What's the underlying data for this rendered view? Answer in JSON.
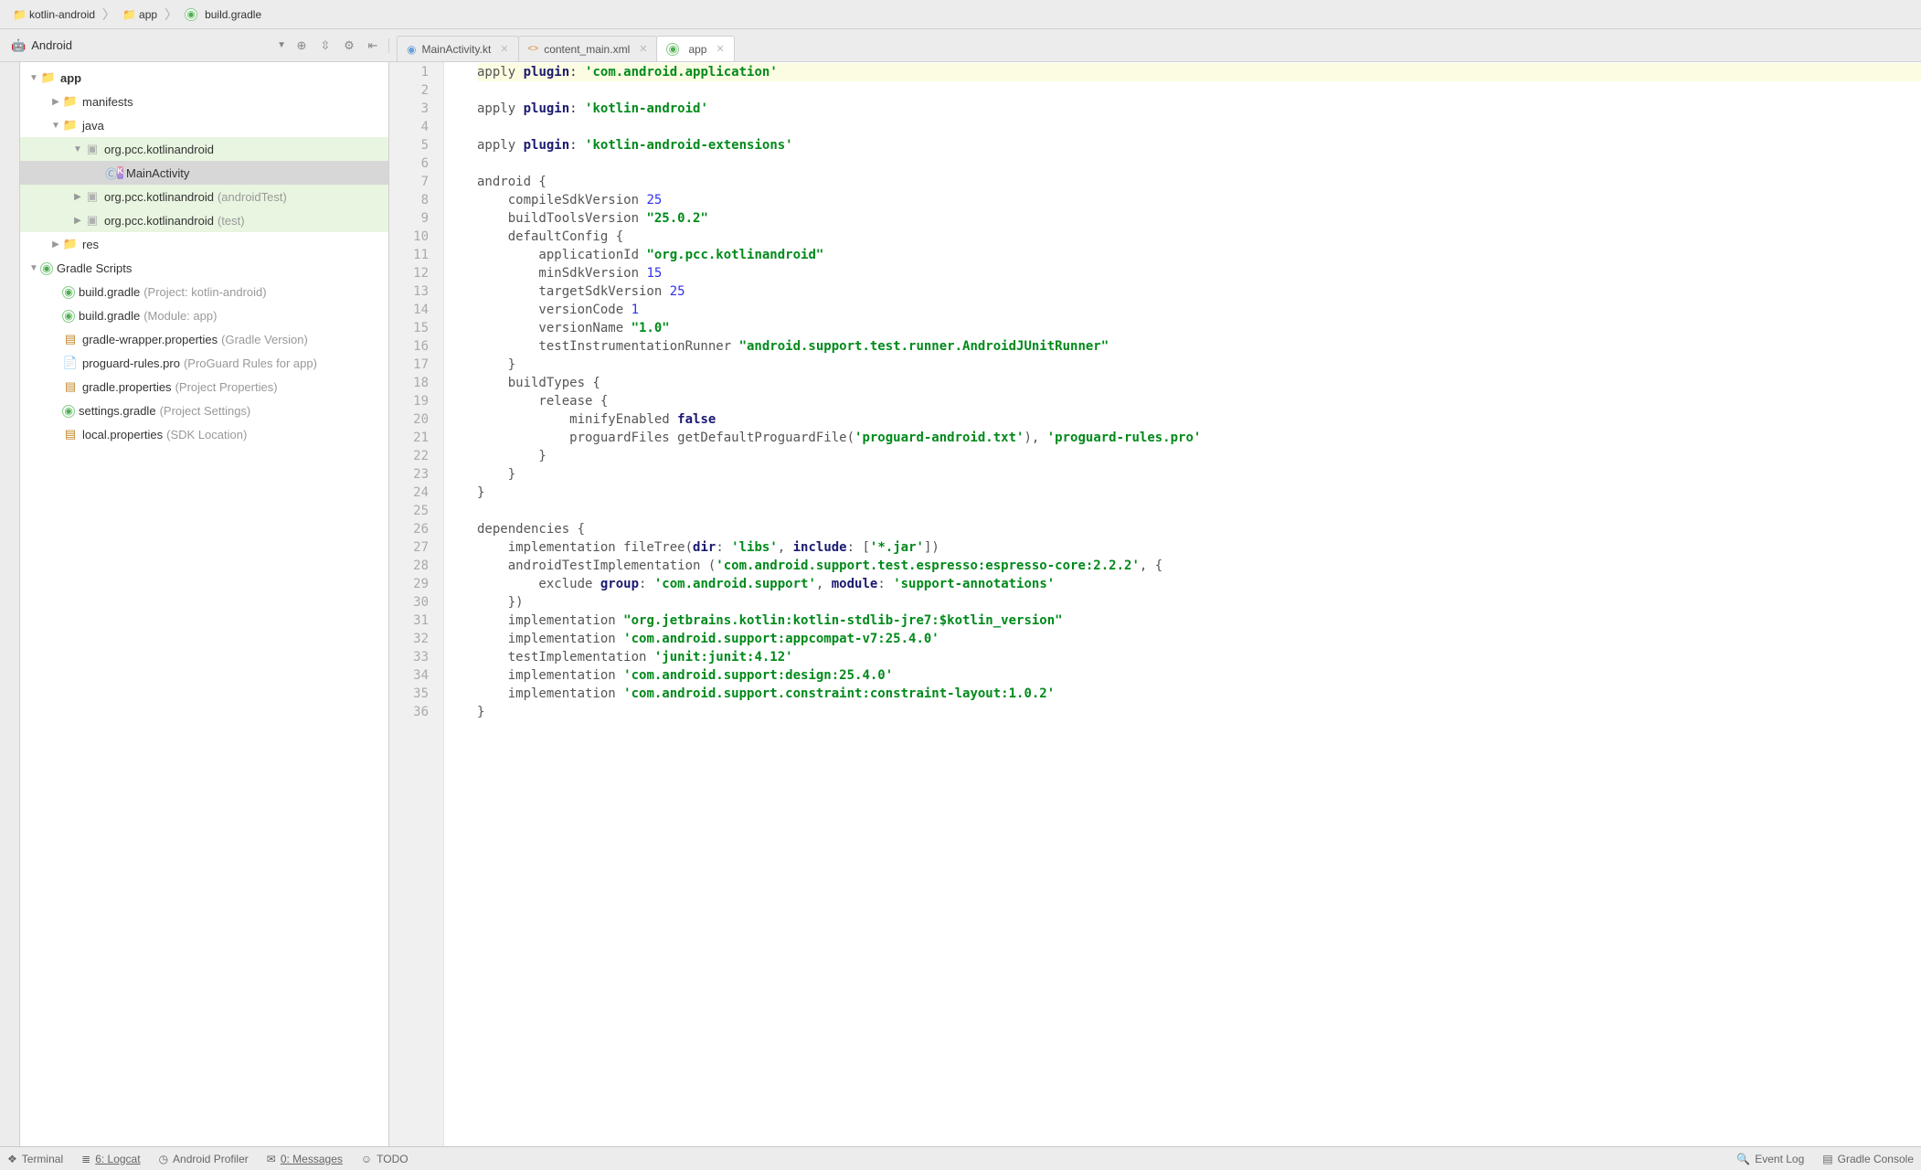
{
  "breadcrumb": [
    "kotlin-android",
    "app",
    "build.gradle"
  ],
  "view_mode": "Android",
  "tabs": [
    {
      "label": "MainActivity.kt",
      "icon": "kotlin-circle",
      "active": false
    },
    {
      "label": "content_main.xml",
      "icon": "xml",
      "active": false
    },
    {
      "label": "app",
      "icon": "gradle",
      "active": true
    }
  ],
  "project_tree": [
    {
      "indent": 0,
      "twist": "down",
      "icon": "folder",
      "label": "app",
      "bold": true
    },
    {
      "indent": 1,
      "twist": "right",
      "icon": "folder",
      "label": "manifests"
    },
    {
      "indent": 1,
      "twist": "down",
      "icon": "folder",
      "label": "java"
    },
    {
      "indent": 2,
      "twist": "down",
      "icon": "folder-grey",
      "label": "org.pcc.kotlinandroid",
      "hl": "green"
    },
    {
      "indent": 3,
      "twist": "none",
      "icon": "kotlin",
      "label": "MainActivity",
      "hl": "sel"
    },
    {
      "indent": 2,
      "twist": "right",
      "icon": "folder-grey",
      "label": "org.pcc.kotlinandroid",
      "hint": "(androidTest)",
      "hl": "green"
    },
    {
      "indent": 2,
      "twist": "right",
      "icon": "folder-grey",
      "label": "org.pcc.kotlinandroid",
      "hint": "(test)",
      "hl": "green"
    },
    {
      "indent": 1,
      "twist": "right",
      "icon": "folder",
      "label": "res"
    },
    {
      "indent": 0,
      "twist": "down",
      "icon": "gradle",
      "label": "Gradle Scripts"
    },
    {
      "indent": 1,
      "twist": "none",
      "icon": "gradle",
      "label": "build.gradle",
      "hint": "(Project: kotlin-android)"
    },
    {
      "indent": 1,
      "twist": "none",
      "icon": "gradle",
      "label": "build.gradle",
      "hint": "(Module: app)"
    },
    {
      "indent": 1,
      "twist": "none",
      "icon": "gradle2",
      "label": "gradle-wrapper.properties",
      "hint": "(Gradle Version)"
    },
    {
      "indent": 1,
      "twist": "none",
      "icon": "file",
      "label": "proguard-rules.pro",
      "hint": "(ProGuard Rules for app)"
    },
    {
      "indent": 1,
      "twist": "none",
      "icon": "gradle2",
      "label": "gradle.properties",
      "hint": "(Project Properties)"
    },
    {
      "indent": 1,
      "twist": "none",
      "icon": "gradle",
      "label": "settings.gradle",
      "hint": "(Project Settings)"
    },
    {
      "indent": 1,
      "twist": "none",
      "icon": "gradle2",
      "label": "local.properties",
      "hint": "(SDK Location)"
    }
  ],
  "code_lines": [
    {
      "n": 1,
      "hl": true,
      "tokens": [
        {
          "t": "apply",
          "c": "nm"
        },
        {
          "t": " "
        },
        {
          "t": "plugin",
          "c": "kw"
        },
        {
          "t": ": "
        },
        {
          "t": "'com.android.application'",
          "c": "str"
        }
      ]
    },
    {
      "n": 2,
      "tokens": []
    },
    {
      "n": 3,
      "tokens": [
        {
          "t": "apply",
          "c": "nm"
        },
        {
          "t": " "
        },
        {
          "t": "plugin",
          "c": "kw"
        },
        {
          "t": ": "
        },
        {
          "t": "'kotlin-android'",
          "c": "str"
        }
      ]
    },
    {
      "n": 4,
      "tokens": []
    },
    {
      "n": 5,
      "tokens": [
        {
          "t": "apply",
          "c": "nm"
        },
        {
          "t": " "
        },
        {
          "t": "plugin",
          "c": "kw"
        },
        {
          "t": ": "
        },
        {
          "t": "'kotlin-android-extensions'",
          "c": "str"
        }
      ]
    },
    {
      "n": 6,
      "tokens": []
    },
    {
      "n": 7,
      "tokens": [
        {
          "t": "android {",
          "c": "nm"
        }
      ]
    },
    {
      "n": 8,
      "tokens": [
        {
          "t": "    compileSdkVersion ",
          "c": "nm"
        },
        {
          "t": "25",
          "c": "num"
        }
      ]
    },
    {
      "n": 9,
      "tokens": [
        {
          "t": "    buildToolsVersion ",
          "c": "nm"
        },
        {
          "t": "\"25.0.2\"",
          "c": "str"
        }
      ]
    },
    {
      "n": 10,
      "tokens": [
        {
          "t": "    defaultConfig {",
          "c": "nm"
        }
      ]
    },
    {
      "n": 11,
      "tokens": [
        {
          "t": "        applicationId ",
          "c": "nm"
        },
        {
          "t": "\"org.pcc.kotlinandroid\"",
          "c": "str"
        }
      ]
    },
    {
      "n": 12,
      "tokens": [
        {
          "t": "        minSdkVersion ",
          "c": "nm"
        },
        {
          "t": "15",
          "c": "num"
        }
      ]
    },
    {
      "n": 13,
      "tokens": [
        {
          "t": "        targetSdkVersion ",
          "c": "nm"
        },
        {
          "t": "25",
          "c": "num"
        }
      ]
    },
    {
      "n": 14,
      "tokens": [
        {
          "t": "        versionCode ",
          "c": "nm"
        },
        {
          "t": "1",
          "c": "num"
        }
      ]
    },
    {
      "n": 15,
      "tokens": [
        {
          "t": "        versionName ",
          "c": "nm"
        },
        {
          "t": "\"1.0\"",
          "c": "str"
        }
      ]
    },
    {
      "n": 16,
      "tokens": [
        {
          "t": "        testInstrumentationRunner ",
          "c": "nm"
        },
        {
          "t": "\"android.support.test.runner.AndroidJUnitRunner\"",
          "c": "str"
        }
      ]
    },
    {
      "n": 17,
      "tokens": [
        {
          "t": "    }",
          "c": "nm"
        }
      ]
    },
    {
      "n": 18,
      "tokens": [
        {
          "t": "    buildTypes {",
          "c": "nm"
        }
      ]
    },
    {
      "n": 19,
      "tokens": [
        {
          "t": "        release {",
          "c": "nm"
        }
      ]
    },
    {
      "n": 20,
      "tokens": [
        {
          "t": "            minifyEnabled ",
          "c": "nm"
        },
        {
          "t": "false",
          "c": "bool"
        }
      ]
    },
    {
      "n": 21,
      "tokens": [
        {
          "t": "            proguardFiles getDefaultProguardFile(",
          "c": "nm"
        },
        {
          "t": "'proguard-android.txt'",
          "c": "str"
        },
        {
          "t": "), ",
          "c": "nm"
        },
        {
          "t": "'proguard-rules.pro'",
          "c": "str"
        }
      ]
    },
    {
      "n": 22,
      "tokens": [
        {
          "t": "        }",
          "c": "nm"
        }
      ]
    },
    {
      "n": 23,
      "tokens": [
        {
          "t": "    }",
          "c": "nm"
        }
      ]
    },
    {
      "n": 24,
      "tokens": [
        {
          "t": "}",
          "c": "nm"
        }
      ]
    },
    {
      "n": 25,
      "tokens": []
    },
    {
      "n": 26,
      "tokens": [
        {
          "t": "dependencies {",
          "c": "nm"
        }
      ]
    },
    {
      "n": 27,
      "tokens": [
        {
          "t": "    implementation fileTree(",
          "c": "nm"
        },
        {
          "t": "dir",
          "c": "kw"
        },
        {
          "t": ": ",
          "c": "nm"
        },
        {
          "t": "'libs'",
          "c": "str"
        },
        {
          "t": ", ",
          "c": "nm"
        },
        {
          "t": "include",
          "c": "kw"
        },
        {
          "t": ": [",
          "c": "nm"
        },
        {
          "t": "'*.jar'",
          "c": "str"
        },
        {
          "t": "])",
          "c": "nm"
        }
      ]
    },
    {
      "n": 28,
      "tokens": [
        {
          "t": "    androidTestImplementation (",
          "c": "nm"
        },
        {
          "t": "'com.android.support.test.espresso:espresso-core:2.2.2'",
          "c": "str"
        },
        {
          "t": ", {",
          "c": "nm"
        }
      ]
    },
    {
      "n": 29,
      "tokens": [
        {
          "t": "        exclude ",
          "c": "nm"
        },
        {
          "t": "group",
          "c": "kw"
        },
        {
          "t": ": ",
          "c": "nm"
        },
        {
          "t": "'com.android.support'",
          "c": "str"
        },
        {
          "t": ", ",
          "c": "nm"
        },
        {
          "t": "module",
          "c": "kw"
        },
        {
          "t": ": ",
          "c": "nm"
        },
        {
          "t": "'support-annotations'",
          "c": "str"
        }
      ]
    },
    {
      "n": 30,
      "tokens": [
        {
          "t": "    })",
          "c": "nm"
        }
      ]
    },
    {
      "n": 31,
      "tokens": [
        {
          "t": "    implementation ",
          "c": "nm"
        },
        {
          "t": "\"org.jetbrains.kotlin:kotlin-stdlib-jre7:$kotlin_version\"",
          "c": "str"
        }
      ]
    },
    {
      "n": 32,
      "tokens": [
        {
          "t": "    implementation ",
          "c": "nm"
        },
        {
          "t": "'com.android.support:appcompat-v7:25.4.0'",
          "c": "str"
        }
      ]
    },
    {
      "n": 33,
      "tokens": [
        {
          "t": "    testImplementation ",
          "c": "nm"
        },
        {
          "t": "'junit:junit:4.12'",
          "c": "str"
        }
      ]
    },
    {
      "n": 34,
      "tokens": [
        {
          "t": "    implementation ",
          "c": "nm"
        },
        {
          "t": "'com.android.support:design:25.4.0'",
          "c": "str"
        }
      ]
    },
    {
      "n": 35,
      "tokens": [
        {
          "t": "    implementation ",
          "c": "nm"
        },
        {
          "t": "'com.android.support.constraint:constraint-layout:1.0.2'",
          "c": "str"
        }
      ]
    },
    {
      "n": 36,
      "tokens": [
        {
          "t": "}",
          "c": "nm"
        }
      ]
    }
  ],
  "bottom_bar": {
    "terminal": "Terminal",
    "logcat": "6: Logcat",
    "profiler": "Android Profiler",
    "messages": "0: Messages",
    "todo": "TODO",
    "eventlog": "Event Log",
    "gradle": "Gradle Console"
  }
}
